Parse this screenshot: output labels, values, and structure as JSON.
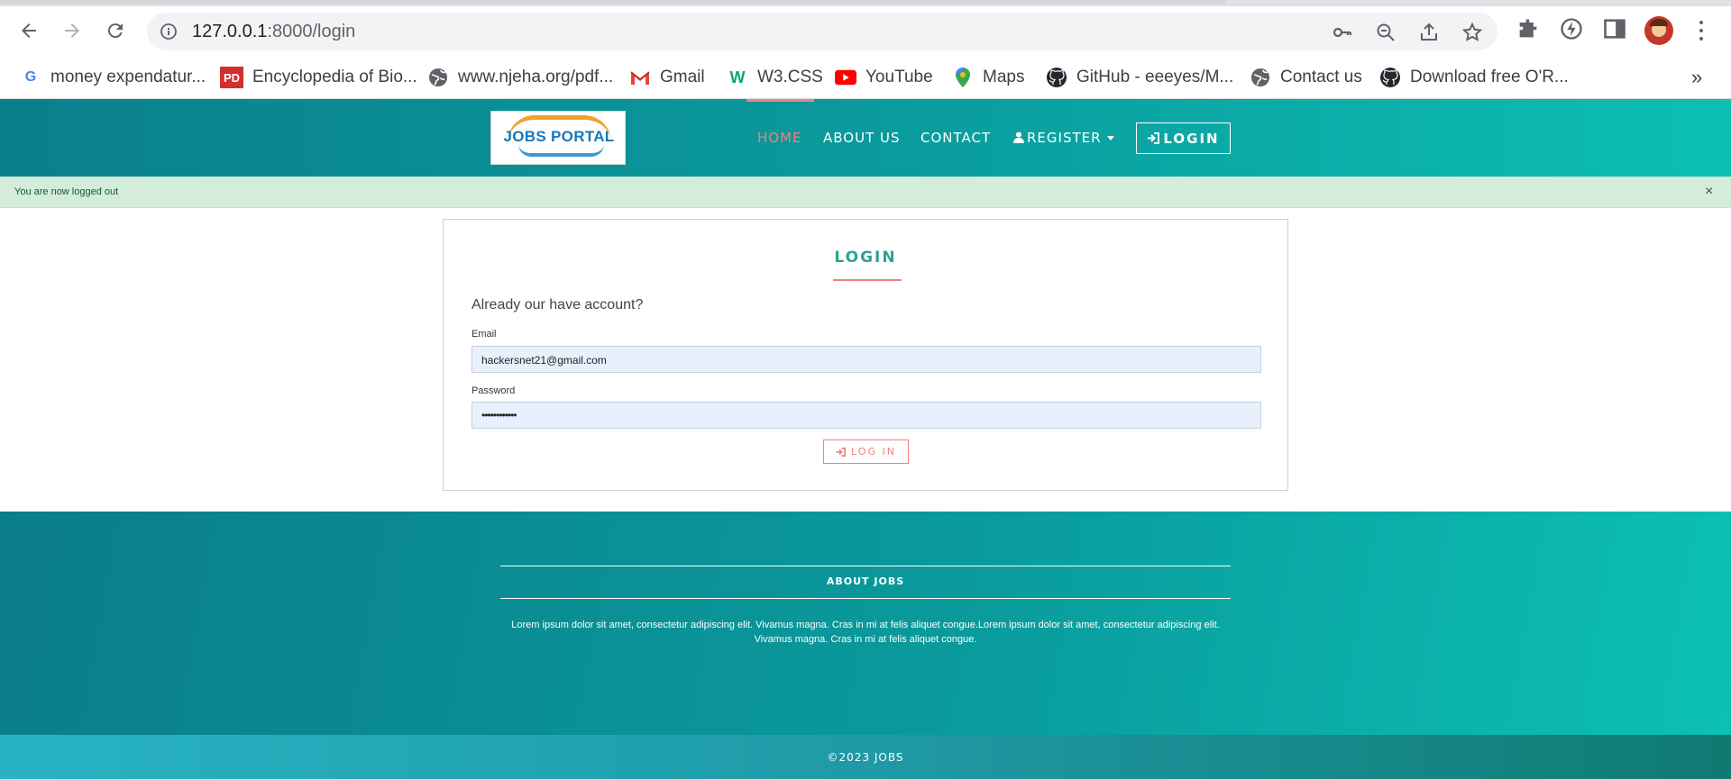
{
  "browser": {
    "url_host": "127.0.0.1",
    "url_path": ":8000/login",
    "bookmarks": [
      {
        "label": "money expendatur...",
        "icon": "google-icon"
      },
      {
        "label": "Encyclopedia of Bio...",
        "icon": "pd-icon"
      },
      {
        "label": "www.njeha.org/pdf...",
        "icon": "globe-icon"
      },
      {
        "label": "Gmail",
        "icon": "gmail-icon"
      },
      {
        "label": "W3.CSS",
        "icon": "w3-icon"
      },
      {
        "label": "YouTube",
        "icon": "youtube-icon"
      },
      {
        "label": "Maps",
        "icon": "maps-icon"
      },
      {
        "label": "GitHub - eeeyes/M...",
        "icon": "github-icon"
      },
      {
        "label": "Contact us",
        "icon": "globe-icon"
      },
      {
        "label": "Download free O'R...",
        "icon": "github-icon"
      }
    ],
    "more_bookmarks": "»"
  },
  "header": {
    "logo_text": "JOBS PORTAL",
    "nav": {
      "home": "HOME",
      "about": "ABOUT US",
      "contact": "CONTACT",
      "register": "REGISTER",
      "login": "LOGIN"
    },
    "active_color": "#f08080"
  },
  "alert": {
    "message": "You are now logged out",
    "close": "×"
  },
  "login_form": {
    "title": "LOGIN",
    "subtitle": "Already our have account?",
    "email_label": "Email",
    "email_value": "hackersnet21@gmail.com",
    "password_label": "Password",
    "password_value": "••••••••••••",
    "submit_label": "LOG IN"
  },
  "footer": {
    "heading": "ABOUT JOBS",
    "text": "Lorem ipsum dolor sit amet, consectetur adipiscing elit. Vivamus magna. Cras in mi at felis aliquet congue.Lorem ipsum dolor sit amet, consectetur adipiscing elit. Vivamus magna. Cras in mi at felis aliquet congue.",
    "copyright": "©2023 JOBS"
  }
}
